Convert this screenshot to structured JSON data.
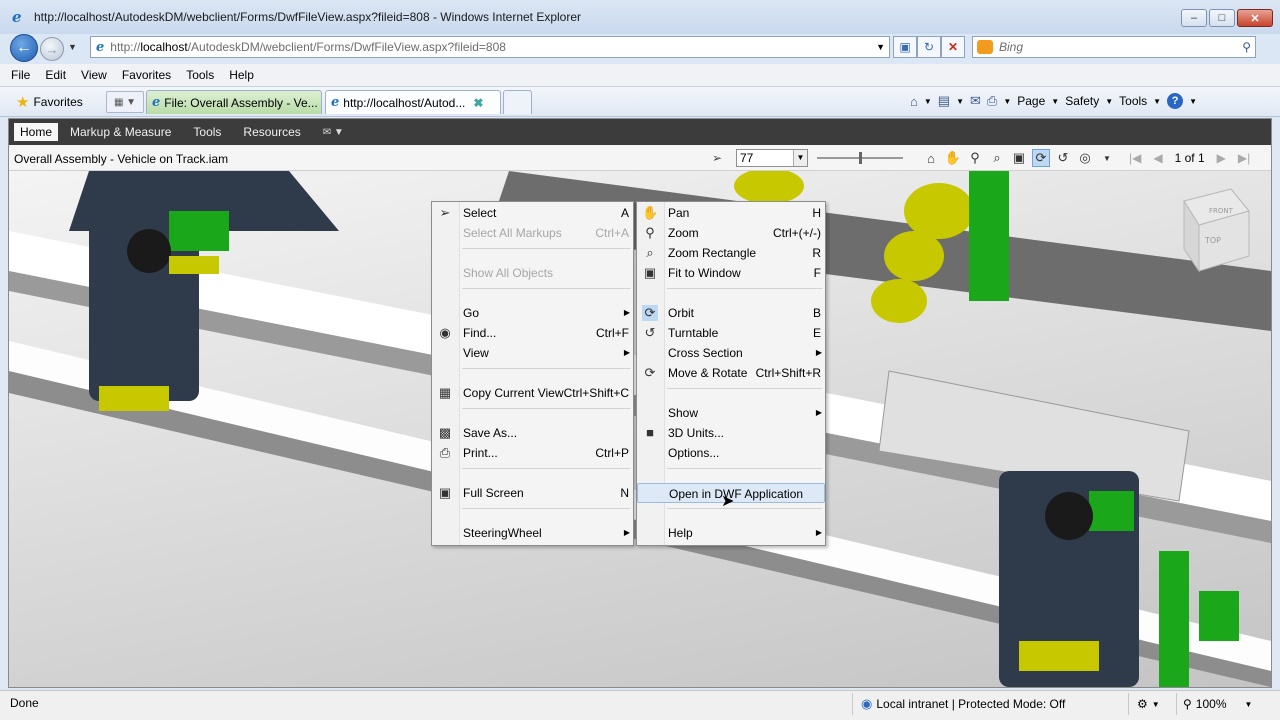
{
  "window": {
    "title": "http://localhost/AutodeskDM/webclient/Forms/DwfFileView.aspx?fileid=808 - Windows Internet Explorer",
    "minimize_icon": "minimize-icon",
    "maximize_icon": "maximize-icon",
    "close_icon": "close-icon"
  },
  "address": {
    "url_prefix": "http://",
    "url_host": "localhost",
    "url_path": "/AutodeskDM/webclient/Forms/DwfFileView.aspx?fileid=808",
    "search_placeholder": "Bing"
  },
  "menubar": [
    "File",
    "Edit",
    "View",
    "Favorites",
    "Tools",
    "Help"
  ],
  "favorites": {
    "label": "Favorites",
    "tabs": [
      {
        "label": "File: Overall Assembly - Ve..."
      },
      {
        "label": "http://localhost/Autod..."
      }
    ],
    "commands": [
      "Page",
      "Safety",
      "Tools"
    ]
  },
  "viewer": {
    "tabs": [
      "Home",
      "Markup & Measure",
      "Tools",
      "Resources"
    ],
    "doc_title": "Overall Assembly - Vehicle on Track.iam",
    "zoom_value": "77",
    "page_label": "1 of 1",
    "viewcube": {
      "front": "FRONT",
      "top": "TOP"
    }
  },
  "context_menu_left": {
    "items": [
      {
        "label": "Select",
        "shortcut": "A",
        "disabled": false,
        "icon": "cursor-icon"
      },
      {
        "label": "Select All Markups",
        "shortcut": "Ctrl+A",
        "disabled": true
      },
      {
        "label": "Show All Objects",
        "shortcut": "",
        "disabled": true
      },
      {
        "label": "Go",
        "shortcut": "",
        "submenu": true
      },
      {
        "label": "Find...",
        "shortcut": "Ctrl+F",
        "icon": "binoculars-icon"
      },
      {
        "label": "View",
        "shortcut": "",
        "submenu": true
      },
      {
        "label": "Copy Current View",
        "shortcut": "Ctrl+Shift+C",
        "icon": "copy-view-icon"
      },
      {
        "label": "Save As...",
        "shortcut": "",
        "icon": "save-icon"
      },
      {
        "label": "Print...",
        "shortcut": "Ctrl+P",
        "icon": "printer-icon"
      },
      {
        "label": "Full Screen",
        "shortcut": "N",
        "icon": "fullscreen-icon"
      },
      {
        "label": "SteeringWheel",
        "shortcut": "",
        "submenu": true
      }
    ]
  },
  "context_menu_right": {
    "items": [
      {
        "label": "Pan",
        "shortcut": "H",
        "icon": "hand-icon"
      },
      {
        "label": "Zoom",
        "shortcut": "Ctrl+(+/-)",
        "icon": "zoom-icon"
      },
      {
        "label": "Zoom Rectangle",
        "shortcut": "R",
        "icon": "zoom-rectangle-icon"
      },
      {
        "label": "Fit to Window",
        "shortcut": "F",
        "icon": "fit-window-icon"
      },
      {
        "label": "Orbit",
        "shortcut": "B",
        "icon": "orbit-icon"
      },
      {
        "label": "Turntable",
        "shortcut": "E",
        "icon": "turntable-icon"
      },
      {
        "label": "Cross Section",
        "shortcut": "",
        "submenu": true
      },
      {
        "label": "Move & Rotate",
        "shortcut": "Ctrl+Shift+R",
        "icon": "move-rotate-icon"
      },
      {
        "label": "Show",
        "shortcut": "",
        "submenu": true
      },
      {
        "label": "3D Units...",
        "shortcut": "",
        "icon": "units-icon"
      },
      {
        "label": "Options...",
        "shortcut": ""
      },
      {
        "label": "Open in DWF Application",
        "shortcut": "",
        "highlighted": true
      },
      {
        "label": "Help",
        "shortcut": "",
        "submenu": true
      }
    ]
  },
  "status": {
    "left": "Done",
    "zone": "Local intranet | Protected Mode: Off",
    "zoom": "100%"
  },
  "colors": {
    "accent": "#1f6fc4",
    "green_parts": "#1aa81a",
    "yellow_parts": "#c8c800",
    "dark_parts": "#2f3a4a"
  }
}
